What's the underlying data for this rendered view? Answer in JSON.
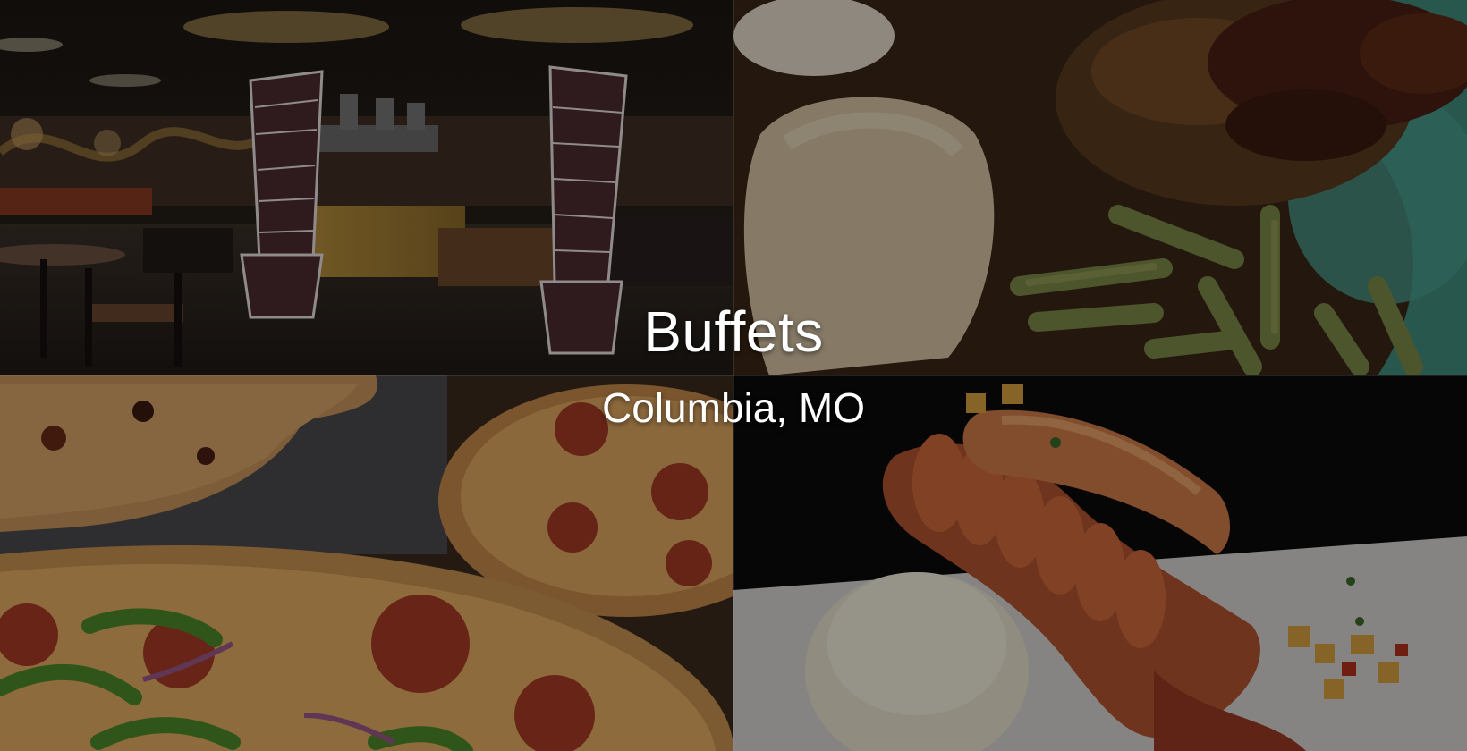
{
  "hero": {
    "title": "Buffets",
    "location": "Columbia, MO"
  },
  "tiles": [
    {
      "name": "restaurant-interior-photo"
    },
    {
      "name": "plated-meal-photo"
    },
    {
      "name": "pizza-photo"
    },
    {
      "name": "lobster-rice-photo"
    }
  ],
  "colors": {
    "text": "#ffffff",
    "overlay": "rgba(0,0,0,0.38)"
  }
}
